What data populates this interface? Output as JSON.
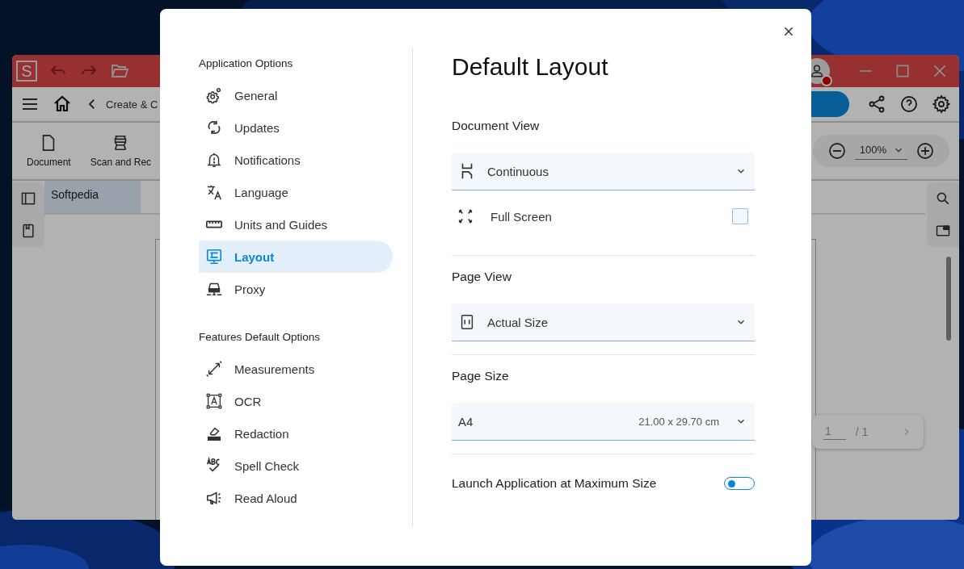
{
  "app": {
    "logo": "S",
    "breadcrumb": "Create & C",
    "ribbon": [
      {
        "label": "Document"
      },
      {
        "label": "Scan and Rec"
      }
    ],
    "zoom": "100%",
    "tabs": [
      {
        "label": "Softpedia",
        "selected": true
      }
    ],
    "pager": {
      "page": "1",
      "total": "/ 1"
    }
  },
  "dialog": {
    "nav": [
      {
        "heading": "Application Options",
        "items": [
          {
            "label": "General",
            "selected": false
          },
          {
            "label": "Updates",
            "selected": false
          },
          {
            "label": "Notifications",
            "selected": false
          },
          {
            "label": "Language",
            "selected": false
          },
          {
            "label": "Units and Guides",
            "selected": false
          },
          {
            "label": "Layout",
            "selected": true
          },
          {
            "label": "Proxy",
            "selected": false
          }
        ]
      },
      {
        "heading": "Features Default Options",
        "items": [
          {
            "label": "Measurements",
            "selected": false
          },
          {
            "label": "OCR",
            "selected": false
          },
          {
            "label": "Redaction",
            "selected": false
          },
          {
            "label": "Spell Check",
            "selected": false
          },
          {
            "label": "Read Aloud",
            "selected": false
          }
        ]
      }
    ],
    "title": "Default Layout",
    "groups": [
      {
        "heading": "Document View",
        "controls": [
          {
            "kind": "select",
            "value": "Continuous"
          },
          {
            "kind": "checkbox",
            "label": "Full Screen",
            "checked": false
          }
        ]
      },
      {
        "heading": "Page View",
        "controls": [
          {
            "kind": "select",
            "value": "Actual Size"
          }
        ]
      },
      {
        "heading": "Page Size",
        "controls": [
          {
            "kind": "select",
            "value": "A4",
            "detail": "21.00 x 29.70 cm"
          }
        ]
      },
      {
        "controls": [
          {
            "kind": "toggle",
            "label": "Launch Application at Maximum Size",
            "on": false
          }
        ]
      }
    ]
  }
}
